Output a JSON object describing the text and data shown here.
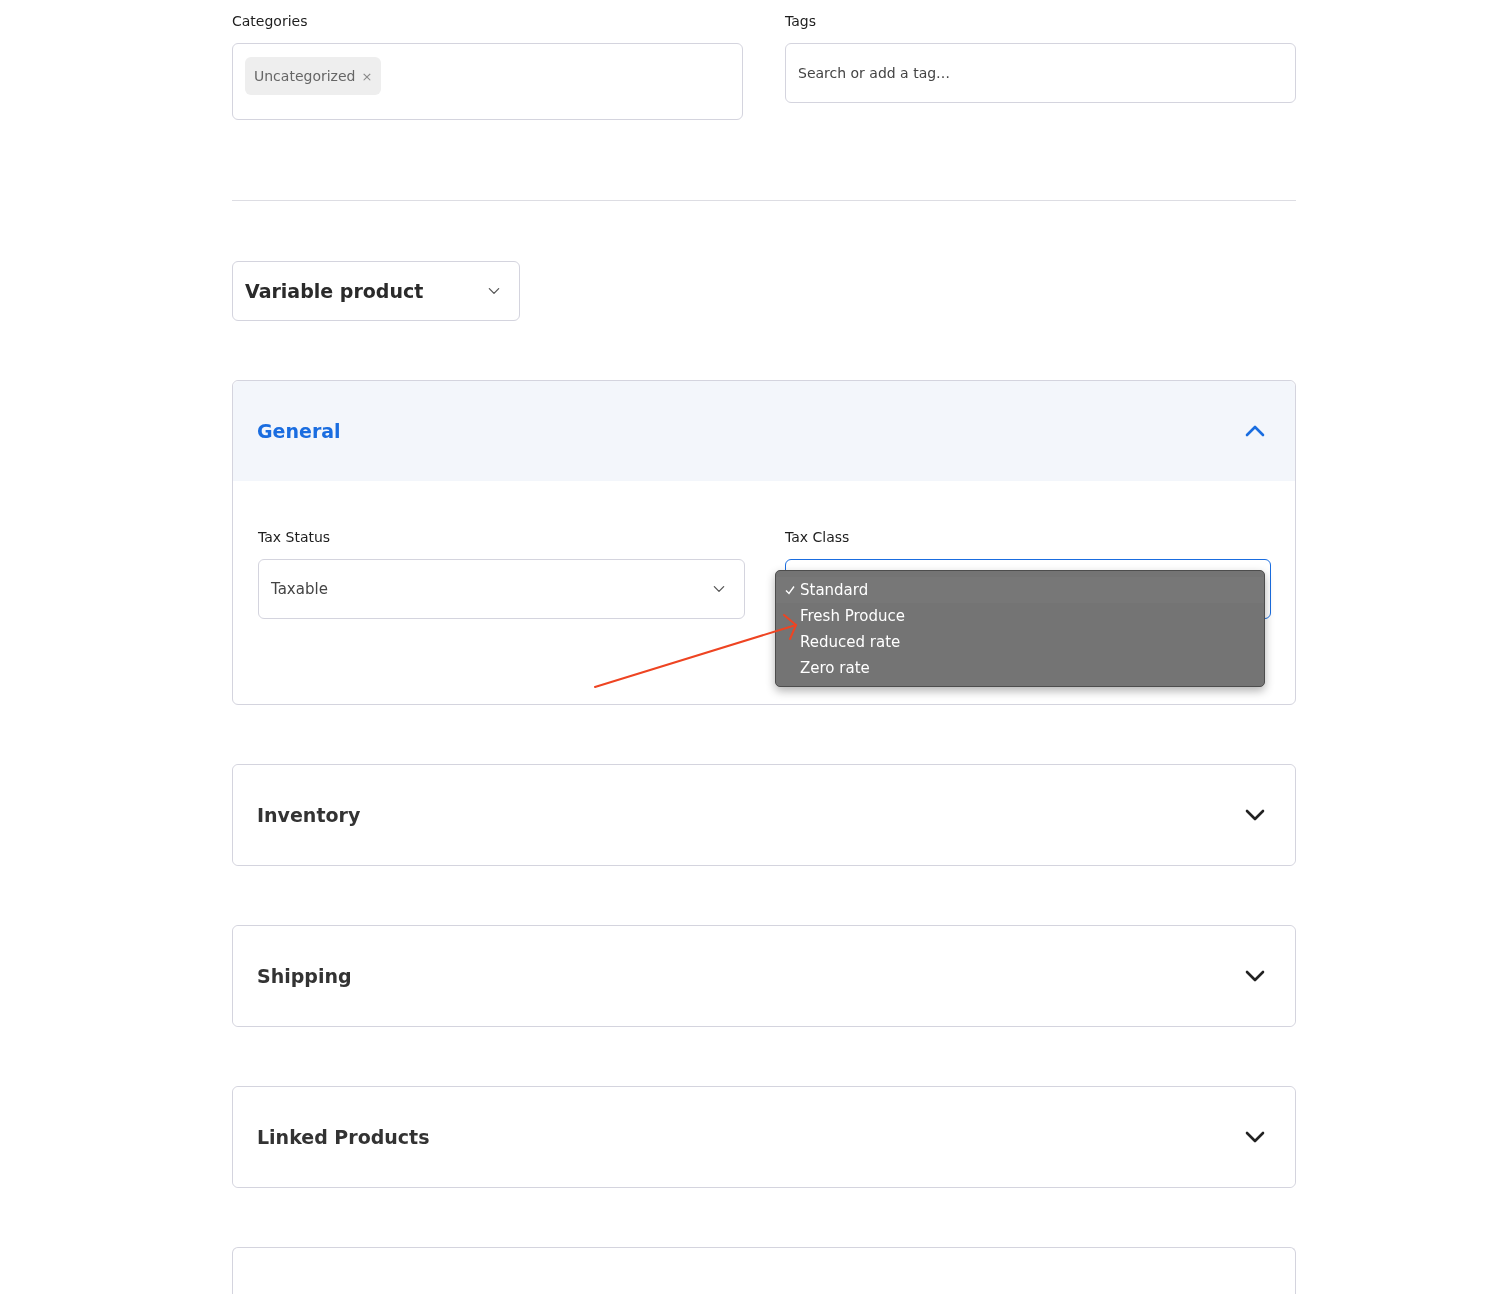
{
  "categories": {
    "label": "Categories",
    "chips": [
      {
        "text": "Uncategorized",
        "remove": "×"
      }
    ]
  },
  "tags": {
    "label": "Tags",
    "placeholder": "Search or add a tag…"
  },
  "product_type": {
    "value": "Variable product"
  },
  "panels": [
    {
      "kind": "section",
      "title": "General",
      "expanded": true,
      "fields": [
        {
          "label": "Tax Status",
          "value": "Taxable",
          "open": false
        },
        {
          "label": "Tax Class",
          "open": true,
          "options": [
            {
              "text": "Standard",
              "selected": true
            },
            {
              "text": "Fresh Produce",
              "selected": false
            },
            {
              "text": "Reduced rate",
              "selected": false
            },
            {
              "text": "Zero rate",
              "selected": false
            }
          ]
        }
      ]
    },
    {
      "kind": "section",
      "title": "Inventory",
      "expanded": false
    },
    {
      "kind": "section",
      "title": "Shipping",
      "expanded": false
    },
    {
      "kind": "section",
      "title": "Linked Products",
      "expanded": false
    },
    {
      "kind": "blank"
    }
  ],
  "annotation": {
    "kind": "arrow"
  }
}
